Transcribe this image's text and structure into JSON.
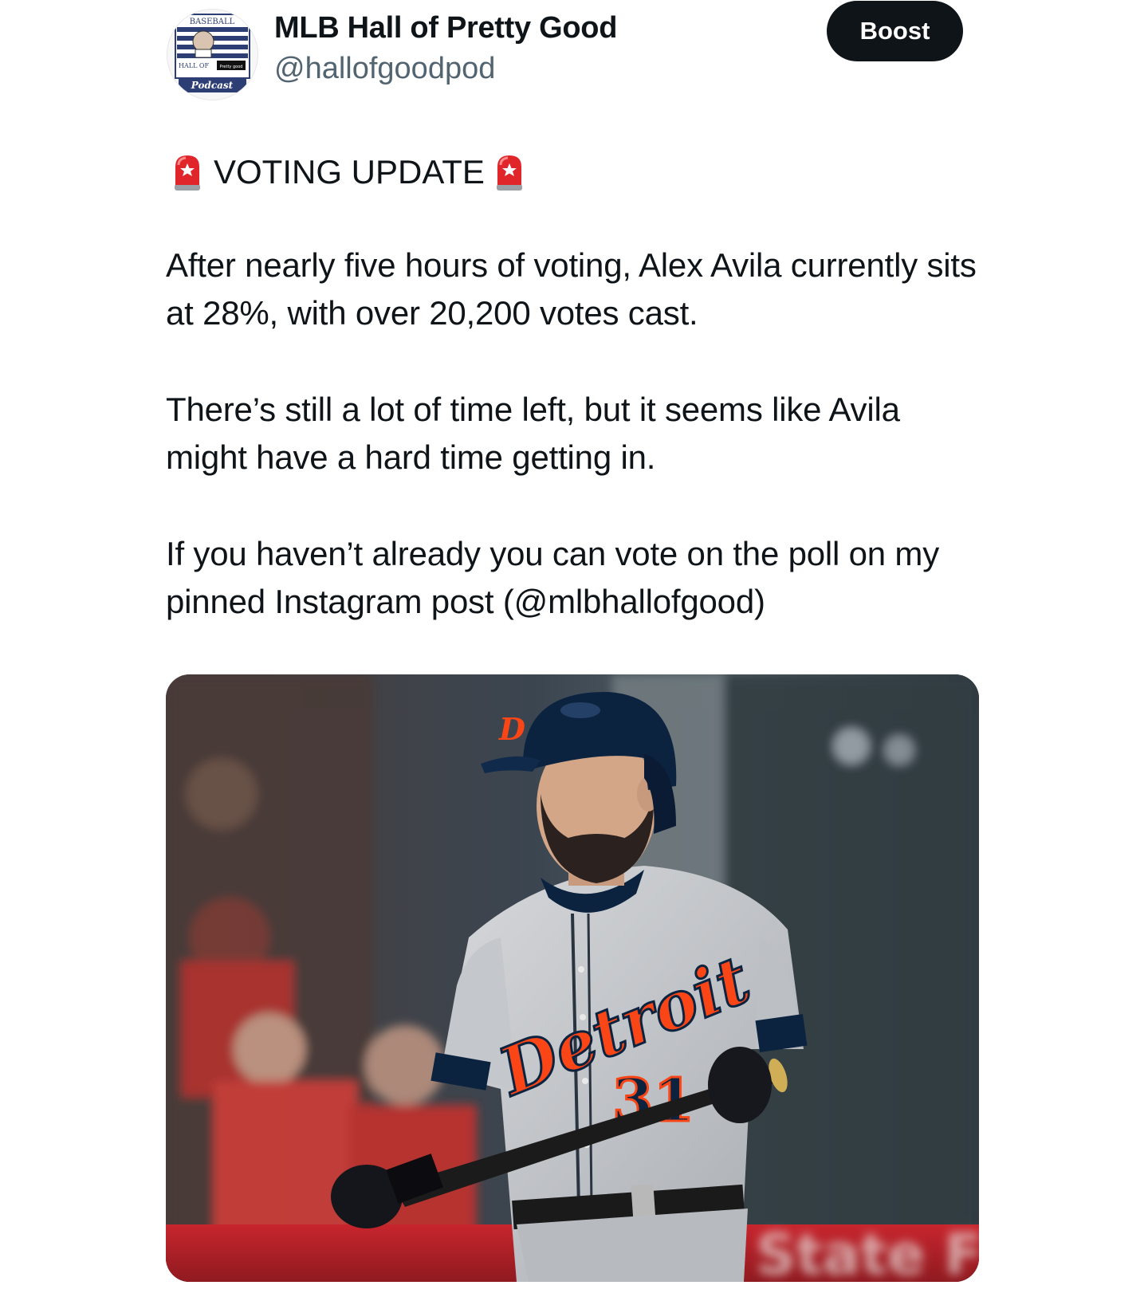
{
  "account": {
    "display_name": "MLB Hall of Pretty Good",
    "handle": "@hallofgoodpod",
    "avatar_text": {
      "top": "BASEBALL",
      "left": "HALL OF",
      "right": "Pretty good",
      "bottom": "Podcast"
    }
  },
  "actions": {
    "boost_label": "Boost"
  },
  "post": {
    "headline": "VOTING UPDATE",
    "headline_emoji": "police-car-light-icon",
    "paragraphs": [
      "After nearly five hours of voting, Alex Avila currently sits at 28%, with over 20,200 votes cast.",
      "There’s still a lot of time left, but it seems like Avila might have a hard time getting in.",
      "If you haven’t already you can vote on the poll on my pinned Instagram post (@mlbhallofgood)"
    ]
  },
  "media": {
    "jersey_text": "Detroit",
    "jersey_number": "31"
  },
  "colors": {
    "text": "#0f1419",
    "secondary_text": "#536471",
    "button_bg": "#0f1419",
    "button_text": "#ffffff",
    "tigers_navy": "#0c2340",
    "tigers_orange": "#fa4616",
    "road_gray": "#c9cbce"
  }
}
